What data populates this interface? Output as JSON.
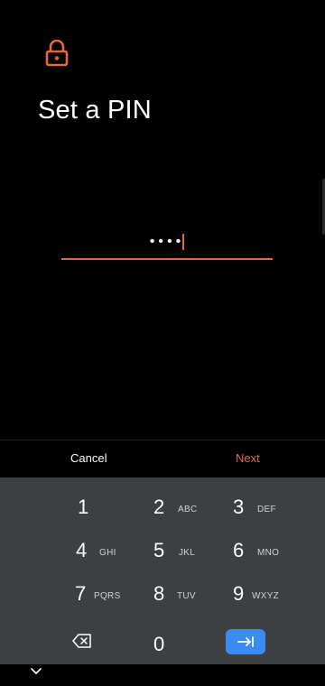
{
  "screen": {
    "title": "Set a PIN",
    "accent_color": "#e8683e",
    "icon": "lock-icon"
  },
  "pin_field": {
    "value": "••••",
    "length": 4
  },
  "actions": {
    "cancel_label": "Cancel",
    "next_label": "Next"
  },
  "keypad": {
    "keys": [
      {
        "digit": "1",
        "letters": ""
      },
      {
        "digit": "2",
        "letters": "ABC"
      },
      {
        "digit": "3",
        "letters": "DEF"
      },
      {
        "digit": "4",
        "letters": "GHI"
      },
      {
        "digit": "5",
        "letters": "JKL"
      },
      {
        "digit": "6",
        "letters": "MNO"
      },
      {
        "digit": "7",
        "letters": "PQRS"
      },
      {
        "digit": "8",
        "letters": "TUV"
      },
      {
        "digit": "9",
        "letters": "WXYZ"
      },
      {
        "digit": "0",
        "letters": ""
      }
    ],
    "backspace_icon": "backspace-icon",
    "enter_icon": "tab-enter-icon",
    "enter_color": "#3b8cf0",
    "background": "#3c4043"
  },
  "nav_bar": {
    "icon": "chevron-down-icon"
  }
}
